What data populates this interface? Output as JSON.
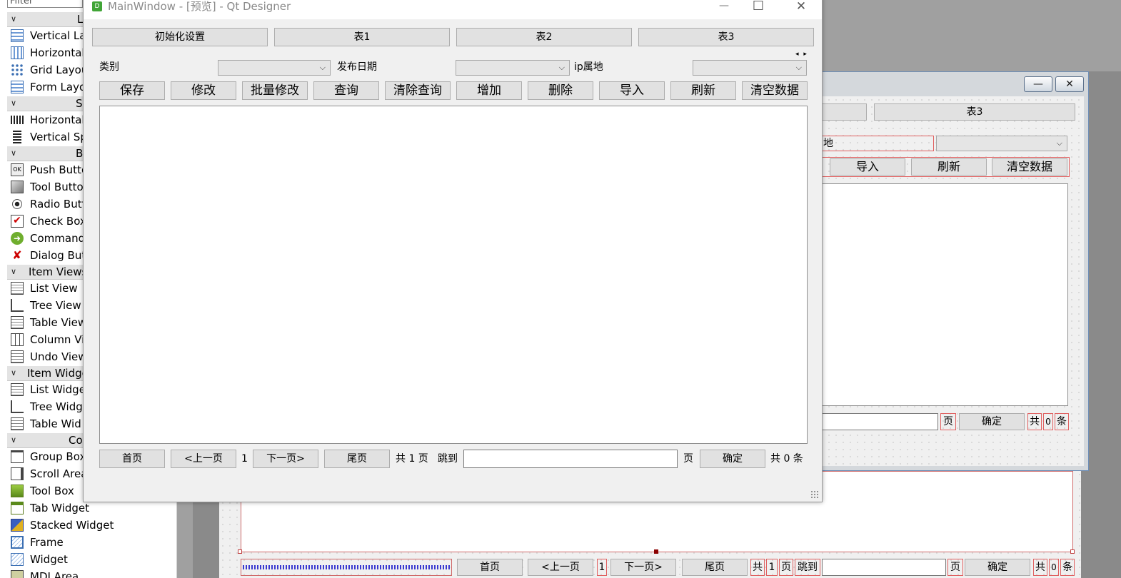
{
  "widget_box": {
    "filter_placeholder": "Filter",
    "categories": [
      {
        "label": "L",
        "arrow": "∨"
      },
      {
        "label": "S",
        "arrow": "∨"
      },
      {
        "label": "B",
        "arrow": "∨"
      },
      {
        "label": "Item Views",
        "arrow": "∨"
      },
      {
        "label": "Item Widge",
        "arrow": "∨"
      },
      {
        "label": "Co",
        "arrow": "∨"
      }
    ],
    "items": [
      {
        "label": "Vertical La",
        "icon": "vertical-layout-icon"
      },
      {
        "label": "Horizontal",
        "icon": "horizontal-layout-icon"
      },
      {
        "label": "Grid Layou",
        "icon": "grid-layout-icon"
      },
      {
        "label": "Form Layo",
        "icon": "form-layout-icon"
      },
      {
        "label": "Horizontal",
        "icon": "horizontal-spacer-icon"
      },
      {
        "label": "Vertical Sp",
        "icon": "vertical-spacer-icon"
      },
      {
        "label": "Push Butto",
        "icon": "push-button-icon",
        "icon_text": "OK"
      },
      {
        "label": "Tool Butto",
        "icon": "tool-button-icon"
      },
      {
        "label": "Radio Butt",
        "icon": "radio-button-icon"
      },
      {
        "label": "Check Box",
        "icon": "check-box-icon"
      },
      {
        "label": "Command",
        "icon": "command-link-icon"
      },
      {
        "label": "Dialog But",
        "icon": "dialog-button-box-icon"
      },
      {
        "label": "List View",
        "icon": "list-view-icon"
      },
      {
        "label": "Tree View",
        "icon": "tree-view-icon"
      },
      {
        "label": "Table View",
        "icon": "table-view-icon"
      },
      {
        "label": "Column Vi",
        "icon": "column-view-icon"
      },
      {
        "label": "Undo View",
        "icon": "undo-view-icon"
      },
      {
        "label": "List Widge",
        "icon": "list-widget-icon"
      },
      {
        "label": "Tree Widg",
        "icon": "tree-widget-icon"
      },
      {
        "label": "Table Wid",
        "icon": "table-widget-icon"
      },
      {
        "label": "Group Box",
        "icon": "group-box-icon"
      },
      {
        "label": "Scroll Area",
        "icon": "scroll-area-icon"
      },
      {
        "label": "Tool Box",
        "icon": "tool-box-icon"
      },
      {
        "label": "Tab Widget",
        "icon": "tab-widget-icon"
      },
      {
        "label": "Stacked Widget",
        "icon": "stacked-widget-icon"
      },
      {
        "label": "Frame",
        "icon": "frame-icon"
      },
      {
        "label": "Widget",
        "icon": "widget-icon"
      },
      {
        "label": "MDI Area",
        "icon": "mdi-area-icon"
      }
    ]
  },
  "preview_window": {
    "app_badge": "D",
    "title": "MainWindow - [预览] - Qt Designer",
    "minimize": "—",
    "maximize": "☐",
    "close": "✕",
    "tabs": [
      "初始化设置",
      "表1",
      "表2",
      "表3"
    ],
    "filters": {
      "category_label": "类别",
      "date_label": "发布日期",
      "ip_label": "ip属地",
      "combo_arrow": "⌵",
      "scroll_arrows": "◂ ▸"
    },
    "actions": [
      "保存",
      "修改",
      "批量修改",
      "查询",
      "清除查询",
      "增加",
      "删除",
      "导入",
      "刷新",
      "清空数据"
    ],
    "pager": {
      "first": "首页",
      "prev": "<上一页",
      "current": "1",
      "next": "下一页>",
      "last": "尾页",
      "total_pages_text": "共 1 页",
      "jump_label": "跳到",
      "page_unit": "页",
      "confirm": "确定",
      "total_records_text": "共 0 条"
    }
  },
  "designer_form": {
    "title_min": "—",
    "title_close": "✕",
    "tab3": "表3",
    "ip_label_partial": "地",
    "actions_visible": [
      "导入",
      "刷新",
      "清空数据"
    ],
    "pager_right": {
      "page_unit": "页",
      "confirm": "确定",
      "total_prefix": "共",
      "total_value": "0",
      "total_suffix": "条"
    },
    "bottom_pager": {
      "first": "首页",
      "prev": "<上一页",
      "current": "1",
      "next": "下一页>",
      "last": "尾页",
      "total_prefix": "共",
      "total_value": "1",
      "page_unit": "页",
      "jump_label": "跳到",
      "page_unit2": "页",
      "confirm": "确定",
      "records_prefix": "共",
      "records_value": "0",
      "records_suffix": "条"
    }
  }
}
